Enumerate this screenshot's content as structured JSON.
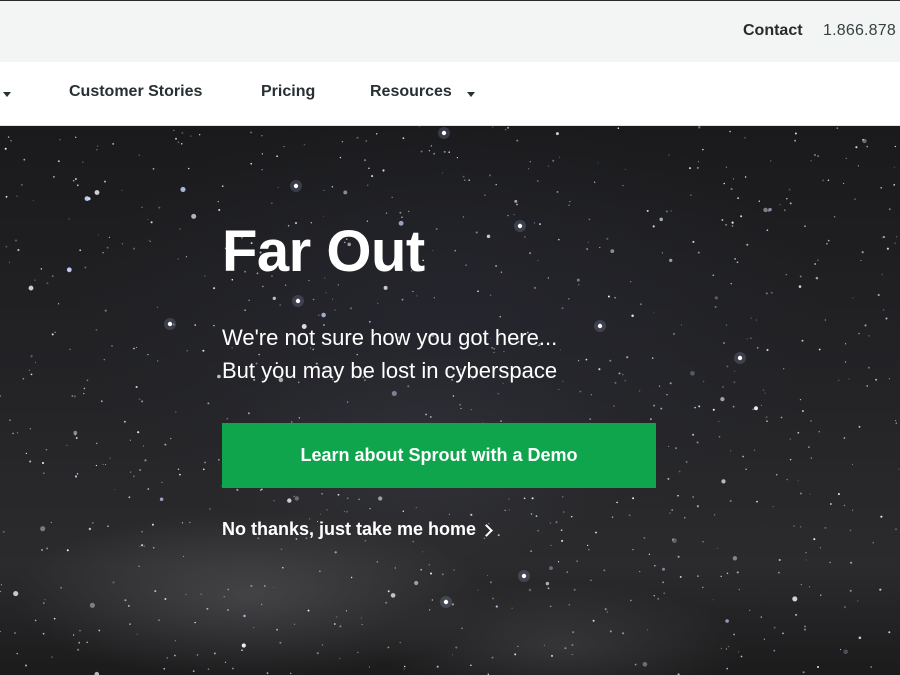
{
  "utility_bar": {
    "contact_label": "Contact",
    "phone": "1.866.878"
  },
  "nav": {
    "items": [
      {
        "label": "Customer Stories",
        "has_dropdown": false
      },
      {
        "label": "Pricing",
        "has_dropdown": false
      },
      {
        "label": "Resources",
        "has_dropdown": true
      }
    ]
  },
  "hero": {
    "title": "Far Out",
    "subtitle_lines": [
      "We're not sure how you got here...",
      "But you may be lost in cyberspace"
    ],
    "cta_label": "Learn about Sprout with a Demo",
    "home_link_label": "No thanks, just take me home"
  },
  "colors": {
    "cta_green": "#0ea54c",
    "utility_bg": "#f3f4f4",
    "nav_text": "#273133"
  },
  "icons": {
    "nav_dropdown": "caret-down-icon",
    "home_link": "chevron-right-icon"
  }
}
